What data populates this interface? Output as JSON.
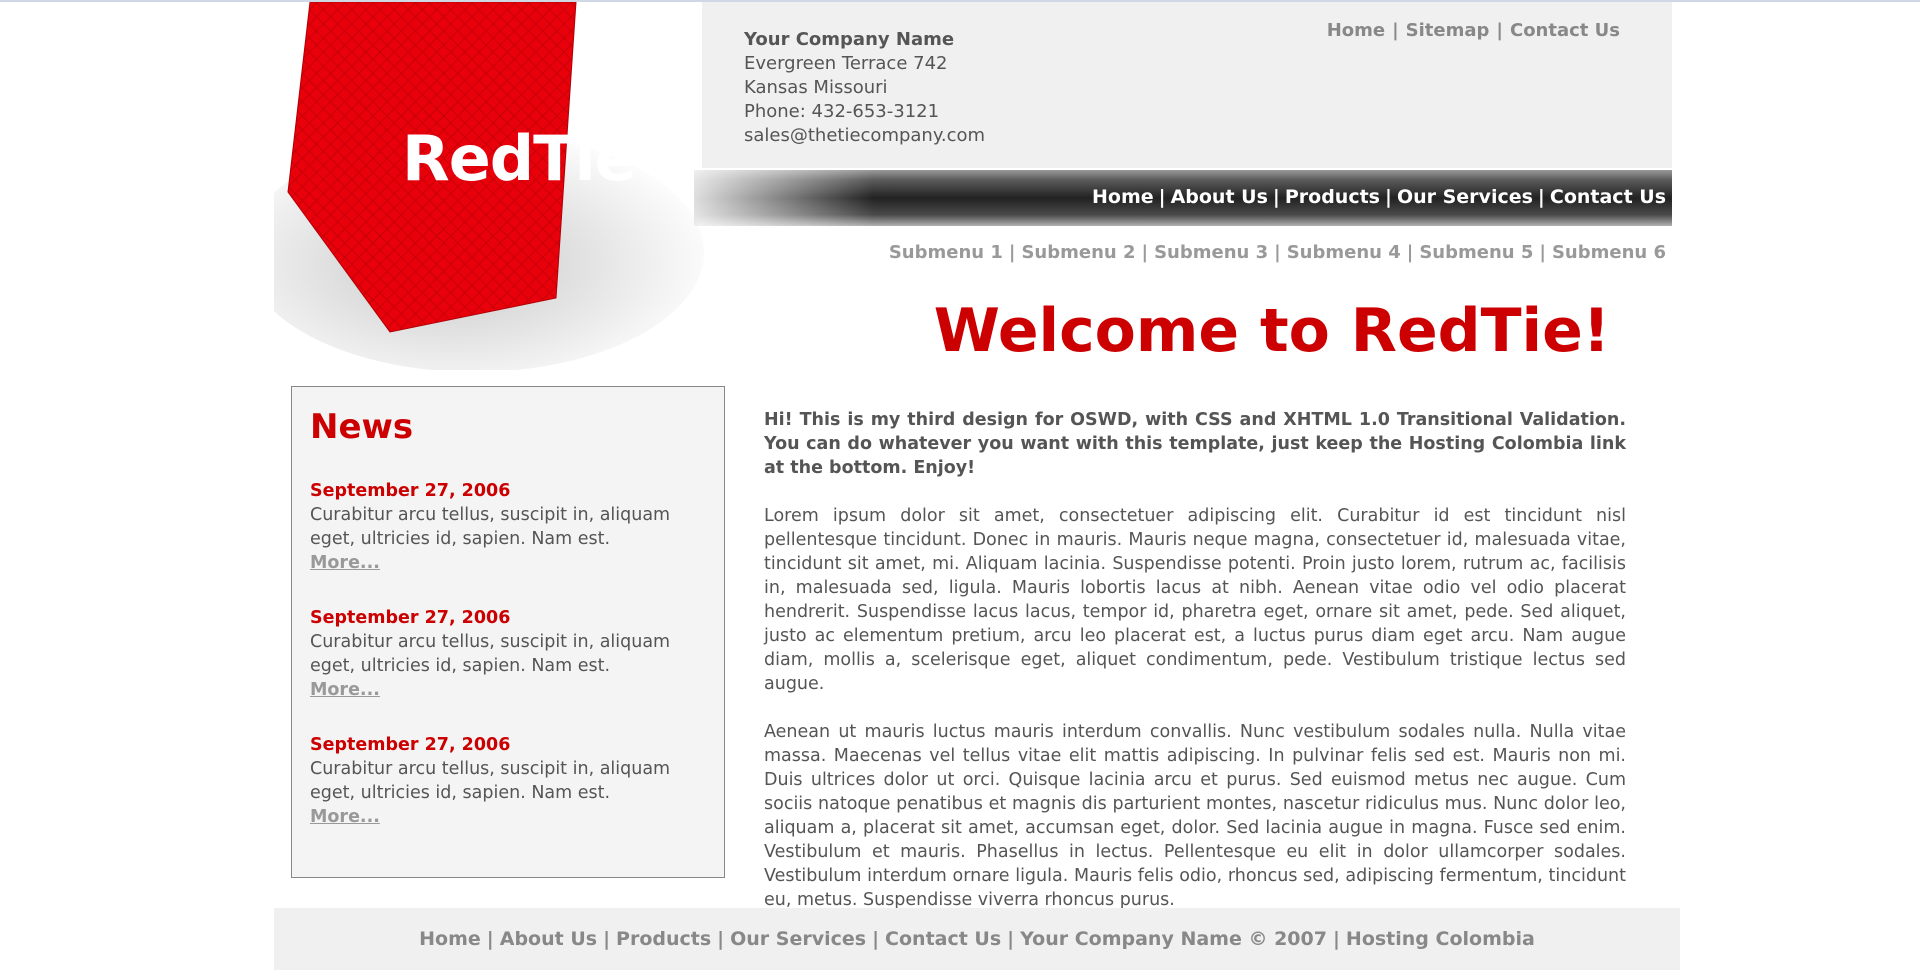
{
  "company": {
    "name": "Your Company Name",
    "address1": "Evergreen Terrace 742",
    "address2": "Kansas Missouri",
    "phone": "Phone: 432-653-3121",
    "email": "sales@thetiecompany.com"
  },
  "logo": {
    "text": "RedTie",
    "color": "#e8000a"
  },
  "top_links": [
    "Home",
    "Sitemap",
    "Contact Us"
  ],
  "main_nav": [
    "Home",
    "About Us",
    "Products",
    "Our Services",
    "Contact Us"
  ],
  "sub_nav": [
    "Submenu 1",
    "Submenu 2",
    "Submenu 3",
    "Submenu 4",
    "Submenu 5",
    "Submenu 6"
  ],
  "welcome": "Welcome to RedTie!",
  "news": {
    "title": "News",
    "items": [
      {
        "date": "September 27, 2006",
        "text": "Curabitur arcu tellus, suscipit in, aliquam eget, ultricies id, sapien. Nam est.",
        "more": "More..."
      },
      {
        "date": "September 27, 2006",
        "text": "Curabitur arcu tellus, suscipit in, aliquam eget, ultricies id, sapien. Nam est.",
        "more": "More..."
      },
      {
        "date": "September 27, 2006",
        "text": "Curabitur arcu tellus, suscipit in, aliquam eget, ultricies id, sapien. Nam est.",
        "more": "More..."
      }
    ]
  },
  "content": {
    "intro": "Hi! This is my third design for OSWD, with CSS and XHTML 1.0 Transitional Validation. You can do whatever you want with this template, just keep the Hosting Colombia link at the bottom. Enjoy!",
    "para1": "Lorem ipsum dolor sit amet, consectetuer adipiscing elit. Curabitur id est tincidunt nisl pellentesque tincidunt. Donec in mauris. Mauris neque magna, consectetuer id, malesuada vitae, tincidunt sit amet, mi. Aliquam lacinia. Suspendisse potenti. Proin justo lorem, rutrum ac, facilisis in, malesuada sed, ligula. Mauris lobortis lacus at nibh. Aenean vitae odio vel odio placerat hendrerit. Suspendisse lacus lacus, tempor id, pharetra eget, ornare sit amet, pede. Sed aliquet, justo ac elementum pretium, arcu leo placerat est, a luctus purus diam eget arcu. Nam augue diam, mollis a, scelerisque eget, aliquet condimentum, pede. Vestibulum tristique lectus sed augue.",
    "para2": "Aenean ut mauris luctus mauris interdum convallis. Nunc vestibulum sodales nulla. Nulla vitae massa. Maecenas vel tellus vitae elit mattis adipiscing. In pulvinar felis sed est. Mauris non mi. Duis ultrices dolor ut orci. Quisque lacinia arcu et purus. Sed euismod metus nec augue. Cum sociis natoque penatibus et magnis dis parturient montes, nascetur ridiculus mus. Nunc dolor leo, aliquam a, placerat sit amet, accumsan eget, dolor. Sed lacinia augue in magna. Fusce sed enim. Vestibulum et mauris. Phasellus in lectus. Pellentesque eu elit in dolor ullamcorper sodales. Vestibulum interdum ornare ligula. Mauris felis odio, rhoncus sed, adipiscing fermentum, tincidunt eu, metus. Suspendisse viverra rhoncus purus."
  },
  "footer": [
    "Home",
    "About Us",
    "Products",
    "Our Services",
    "Contact Us",
    "Your Company Name © 2007",
    "Hosting Colombia"
  ]
}
